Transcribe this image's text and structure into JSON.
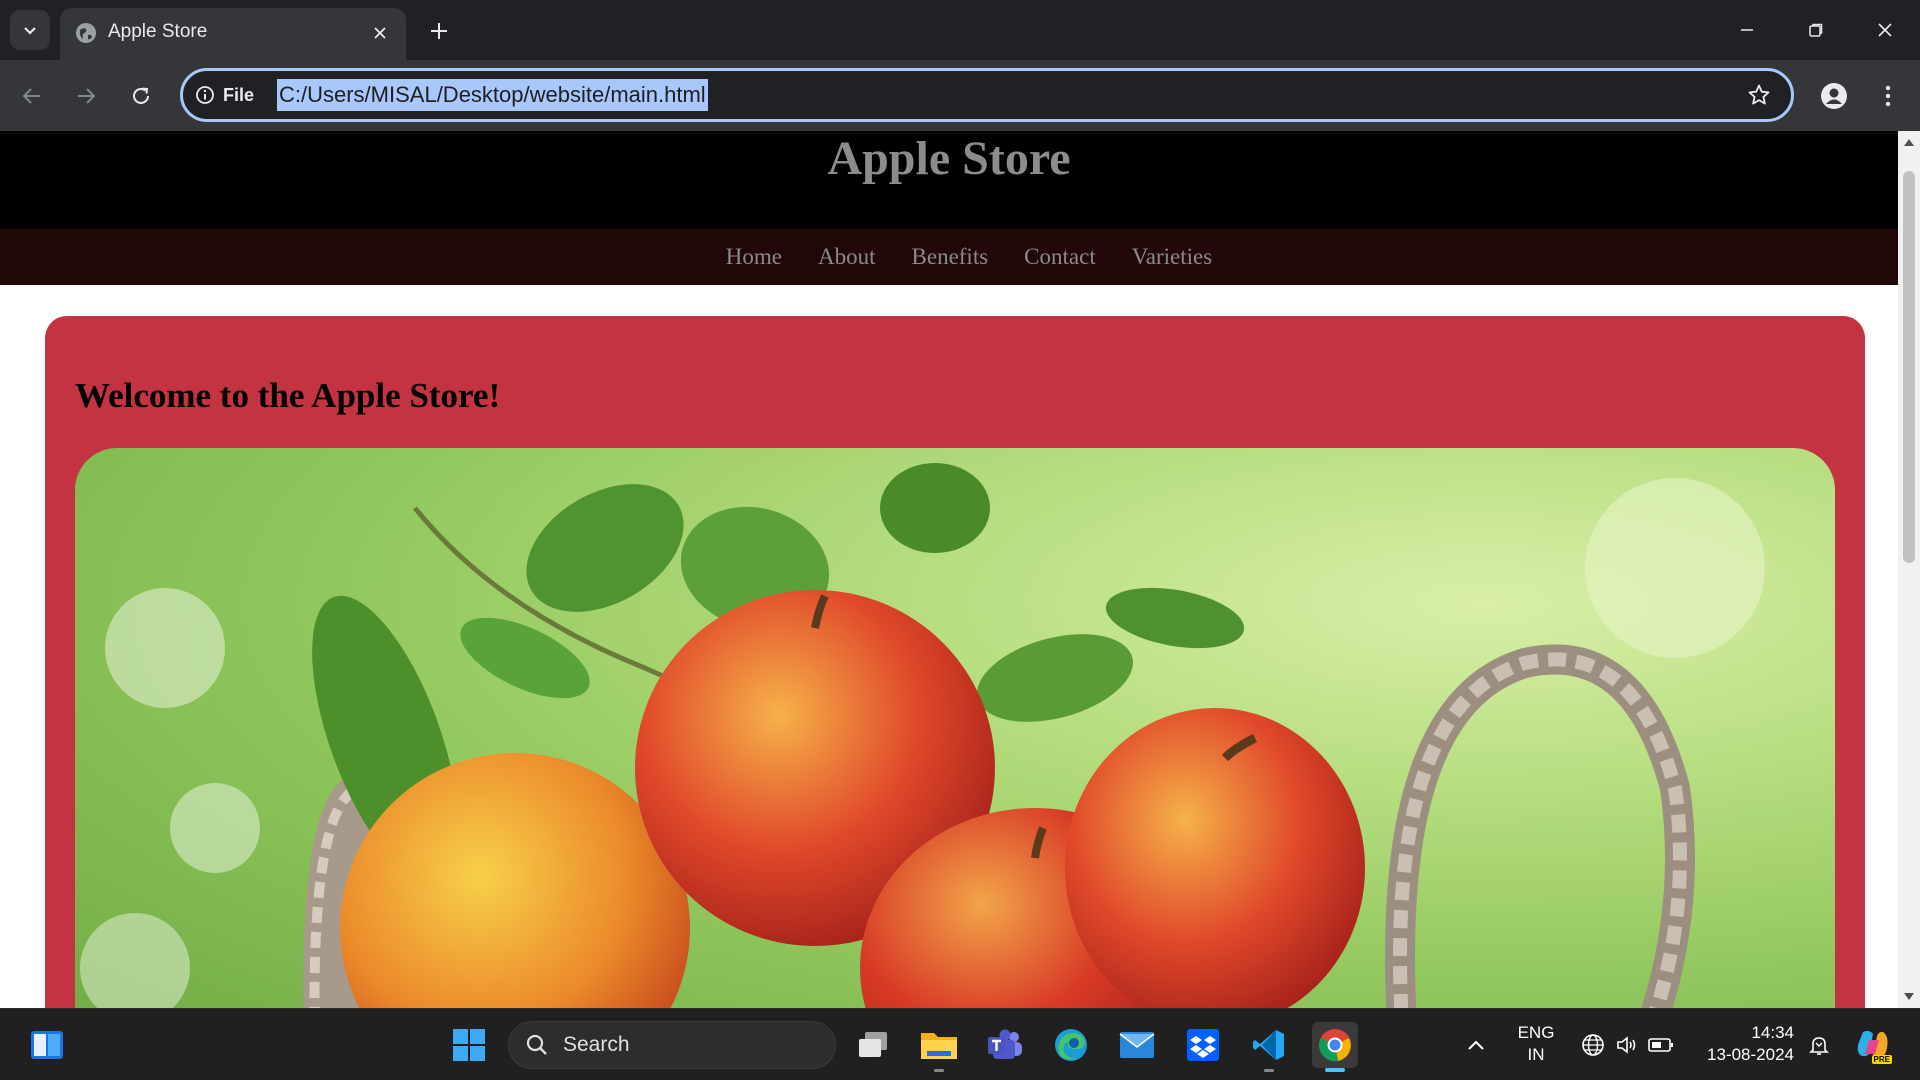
{
  "browser": {
    "tab_title": "Apple Store",
    "site_info_label": "File",
    "url": "C:/Users/MISAL/Desktop/website/main.html"
  },
  "page": {
    "site_title": "Apple Store",
    "nav": [
      "Home",
      "About",
      "Benefits",
      "Contact",
      "Varieties"
    ],
    "welcome_heading": "Welcome to the Apple Store!",
    "hero_image": "apples-in-wicker-basket",
    "colors": {
      "header_bg": "#000000",
      "nav_bg": "#210707",
      "card_bg": "#c43341",
      "title_color": "#8c8c8c"
    }
  },
  "taskbar": {
    "search_placeholder": "Search",
    "language": "ENG",
    "region": "IN",
    "time": "14:34",
    "date": "13-08-2024",
    "copilot_badge": "PRE",
    "apps": [
      "start",
      "search",
      "task-view",
      "file-explorer",
      "teams",
      "edge",
      "mail",
      "dropbox",
      "vscode",
      "chrome"
    ]
  }
}
